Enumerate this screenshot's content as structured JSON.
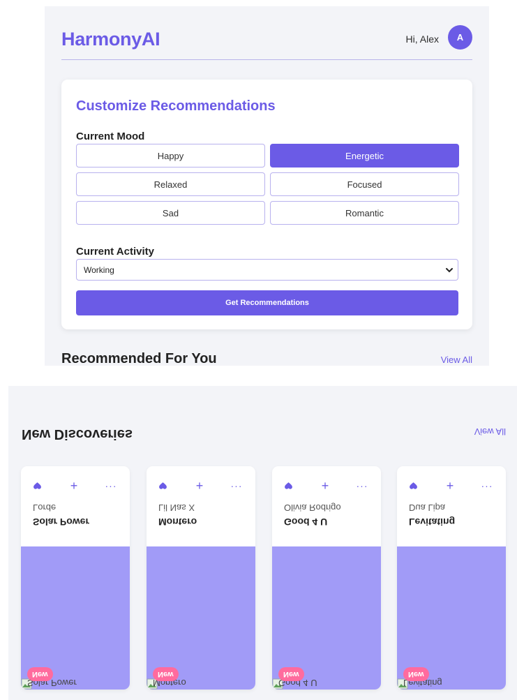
{
  "header": {
    "logo": "HarmonyAI",
    "greeting": "Hi, Alex",
    "avatar_initial": "A"
  },
  "customize": {
    "title": "Customize Recommendations",
    "mood_label": "Current Mood",
    "moods": [
      {
        "label": "Happy",
        "active": false
      },
      {
        "label": "Energetic",
        "active": true
      },
      {
        "label": "Relaxed",
        "active": false
      },
      {
        "label": "Focused",
        "active": false
      },
      {
        "label": "Sad",
        "active": false
      },
      {
        "label": "Romantic",
        "active": false
      }
    ],
    "activity_label": "Current Activity",
    "activity_selected": "Working",
    "submit_label": "Get Recommendations"
  },
  "recommended": {
    "heading": "Recommended For You",
    "view_all": "View All"
  },
  "discoveries": {
    "heading": "New Discoveries",
    "view_all": "View All",
    "cards": [
      {
        "title": "Solar Power",
        "artist": "Lorde",
        "badge": "New",
        "art_alt": "Solar Power"
      },
      {
        "title": "Montero",
        "artist": "Lil Nas X",
        "badge": "New",
        "art_alt": "Montero"
      },
      {
        "title": "Good 4 U",
        "artist": "Olivia Rodrigo",
        "badge": "New",
        "art_alt": "Good 4 U"
      },
      {
        "title": "Levitating",
        "artist": "Dua Lipa",
        "badge": "New",
        "art_alt": "Levitating"
      }
    ],
    "actions": {
      "add": "+",
      "more": "···"
    }
  },
  "colors": {
    "accent": "#6b5be6",
    "badge": "#ff6b9e",
    "art_placeholder": "#a19bf7",
    "panel_bg": "#f3f4f8"
  },
  "icons": [
    "heart-icon",
    "plus-icon",
    "more-icon",
    "chevron-down-icon",
    "broken-image-icon"
  ]
}
